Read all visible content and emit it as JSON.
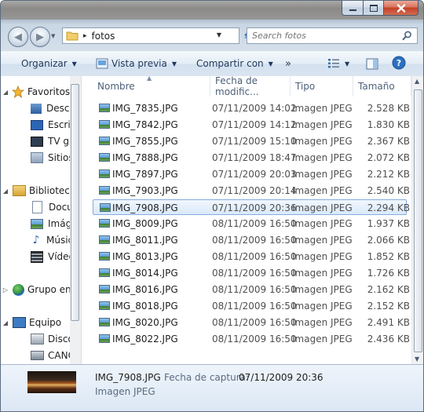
{
  "window": {
    "caption_buttons": [
      "minimize-icon",
      "maximize-icon",
      "close-icon"
    ]
  },
  "nav": {
    "path_separator": "▸",
    "path_folder": "fotos",
    "search_placeholder": "Search fotos"
  },
  "toolbar": {
    "organize": "Organizar",
    "preview": "Vista previa",
    "share": "Compartir con",
    "more": "»"
  },
  "sidebar": {
    "items": [
      {
        "label": "Favoritos",
        "icon": "star-icon"
      },
      {
        "label": "Descargas",
        "icon": "downloads-icon"
      },
      {
        "label": "Escritorio",
        "icon": "desktop-icon"
      },
      {
        "label": "TV grabada",
        "icon": "tv-icon"
      },
      {
        "label": "Sitios recientes",
        "icon": "recent-places-icon"
      },
      {
        "label": "Bibliotecas",
        "icon": "library-icon"
      },
      {
        "label": "Documentos",
        "icon": "document-icon"
      },
      {
        "label": "Imágenes",
        "icon": "pictures-icon"
      },
      {
        "label": "Música",
        "icon": "music-icon"
      },
      {
        "label": "Vídeos",
        "icon": "videos-icon"
      },
      {
        "label": "Grupo en el hogar",
        "icon": "homegroup-icon"
      },
      {
        "label": "Equipo",
        "icon": "computer-icon"
      },
      {
        "label": "Disco local (C:)",
        "icon": "drive-icon"
      },
      {
        "label": "CANON_DC (E:)",
        "icon": "removable-drive-icon"
      }
    ]
  },
  "columns": {
    "name": "Nombre",
    "date": "Fecha de modific...",
    "type": "Tipo",
    "size": "Tamaño"
  },
  "files": [
    {
      "name": "IMG_7835.JPG",
      "date": "07/11/2009 14:02",
      "type": "Imagen JPEG",
      "size": "2.528 KB"
    },
    {
      "name": "IMG_7842.JPG",
      "date": "07/11/2009 14:12",
      "type": "Imagen JPEG",
      "size": "1.830 KB"
    },
    {
      "name": "IMG_7855.JPG",
      "date": "07/11/2009 15:10",
      "type": "Imagen JPEG",
      "size": "2.367 KB"
    },
    {
      "name": "IMG_7888.JPG",
      "date": "07/11/2009 18:47",
      "type": "Imagen JPEG",
      "size": "2.072 KB"
    },
    {
      "name": "IMG_7897.JPG",
      "date": "07/11/2009 20:03",
      "type": "Imagen JPEG",
      "size": "2.212 KB"
    },
    {
      "name": "IMG_7903.JPG",
      "date": "07/11/2009 20:14",
      "type": "Imagen JPEG",
      "size": "2.540 KB"
    },
    {
      "name": "IMG_7908.JPG",
      "date": "07/11/2009 20:36",
      "type": "Imagen JPEG",
      "size": "2.294 KB",
      "selected": true
    },
    {
      "name": "IMG_8009.JPG",
      "date": "08/11/2009 16:50",
      "type": "Imagen JPEG",
      "size": "1.937 KB"
    },
    {
      "name": "IMG_8011.JPG",
      "date": "08/11/2009 16:50",
      "type": "Imagen JPEG",
      "size": "2.066 KB"
    },
    {
      "name": "IMG_8013.JPG",
      "date": "08/11/2009 16:50",
      "type": "Imagen JPEG",
      "size": "1.852 KB"
    },
    {
      "name": "IMG_8014.JPG",
      "date": "08/11/2009 16:50",
      "type": "Imagen JPEG",
      "size": "1.726 KB"
    },
    {
      "name": "IMG_8016.JPG",
      "date": "08/11/2009 16:50",
      "type": "Imagen JPEG",
      "size": "2.162 KB"
    },
    {
      "name": "IMG_8018.JPG",
      "date": "08/11/2009 16:50",
      "type": "Imagen JPEG",
      "size": "2.152 KB"
    },
    {
      "name": "IMG_8020.JPG",
      "date": "08/11/2009 16:50",
      "type": "Imagen JPEG",
      "size": "2.491 KB"
    },
    {
      "name": "IMG_8022.JPG",
      "date": "08/11/2009 16:50",
      "type": "Imagen JPEG",
      "size": "2.436 KB"
    }
  ],
  "details": {
    "filename": "IMG_7908.JPG",
    "capture_label": "Fecha de captura:",
    "capture_value": "07/11/2009 20:36",
    "filetype": "Imagen JPEG"
  },
  "colors": {
    "accent": "#1e395b",
    "selection_border": "#84acdd",
    "selection_fill": "#d9e9fb"
  }
}
